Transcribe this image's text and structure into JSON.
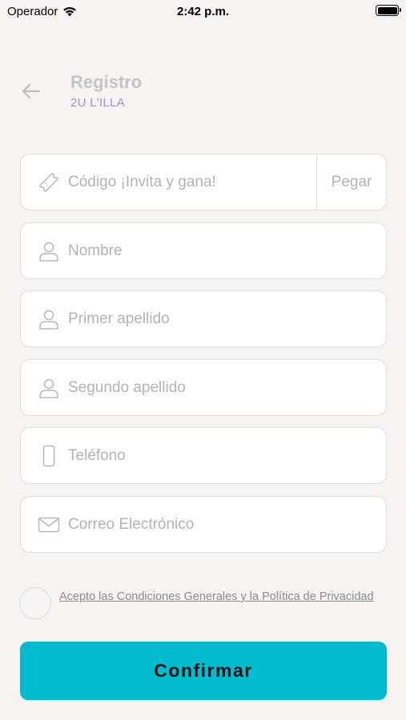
{
  "status_bar": {
    "carrier": "Operador",
    "time": "2:42 p.m.",
    "icons": [
      "wifi-icon",
      "battery-icon"
    ]
  },
  "header": {
    "title": "Registro",
    "subtitle": "2U L'ILLA",
    "back_icon": "arrow-left-icon"
  },
  "form": {
    "invite_code": {
      "placeholder": "Código ¡Invita y gana!",
      "value": "",
      "icon": "ticket-icon",
      "paste_label": "Pegar"
    },
    "first_name": {
      "placeholder": "Nombre",
      "value": "",
      "icon": "user-icon"
    },
    "last_name_1": {
      "placeholder": "Primer apellido",
      "value": "",
      "icon": "user-icon"
    },
    "last_name_2": {
      "placeholder": "Segundo apellido",
      "value": "",
      "icon": "user-icon"
    },
    "phone": {
      "placeholder": "Teléfono",
      "value": "",
      "icon": "phone-icon"
    },
    "email": {
      "placeholder": "Correo Electrónico",
      "value": "",
      "icon": "mail-icon"
    }
  },
  "terms": {
    "label": "Acepto las Condiciones Generales y la Política de Privacidad",
    "checked": false
  },
  "confirm_label": "Confirmar",
  "colors": {
    "background": "#f6f3f1",
    "accent": "#00bcce",
    "subtitle": "#8d97cf",
    "placeholder": "#b3b3b3"
  }
}
